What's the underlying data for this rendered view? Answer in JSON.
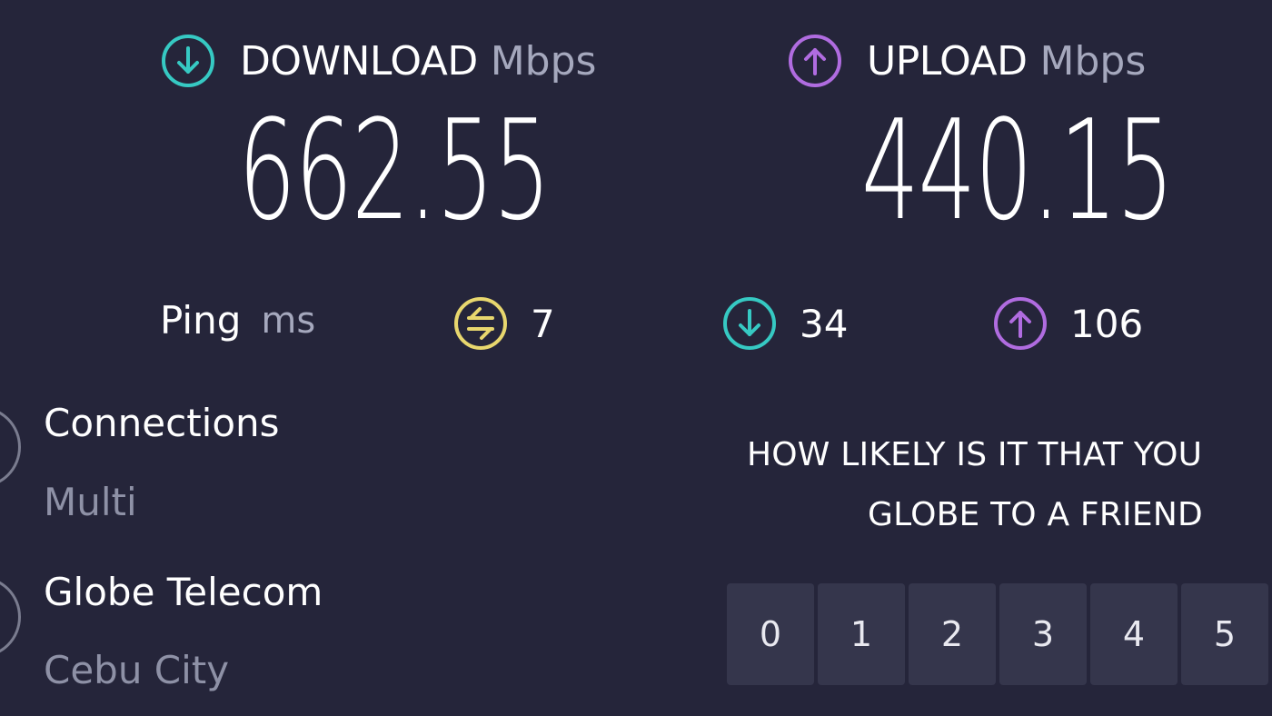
{
  "download": {
    "label": "DOWNLOAD",
    "unit": "Mbps",
    "value": "662.55",
    "icon": "download-arrow-icon",
    "color": "#36c9c3"
  },
  "upload": {
    "label": "UPLOAD",
    "unit": "Mbps",
    "value": "440.15",
    "icon": "upload-arrow-icon",
    "color": "#b06ce0"
  },
  "ping": {
    "label": "Ping",
    "unit": "ms",
    "idle": {
      "value": "7",
      "icon": "ping-exchange-icon",
      "color": "#e8d76e"
    },
    "download": {
      "value": "34",
      "icon": "download-arrow-icon",
      "color": "#36c9c3"
    },
    "upload": {
      "value": "106",
      "icon": "upload-arrow-icon",
      "color": "#b06ce0"
    }
  },
  "connections": {
    "title": "Connections",
    "value": "Multi"
  },
  "server": {
    "provider": "Globe Telecom",
    "location": "Cebu City"
  },
  "survey": {
    "line1": "HOW LIKELY IS IT THAT YOU",
    "line2": "GLOBE TO A FRIEND",
    "ratings": [
      "0",
      "1",
      "2",
      "3",
      "4",
      "5"
    ]
  },
  "colors": {
    "background": "#25253a",
    "button": "#35364c",
    "muted_text": "#a5a8bd"
  }
}
